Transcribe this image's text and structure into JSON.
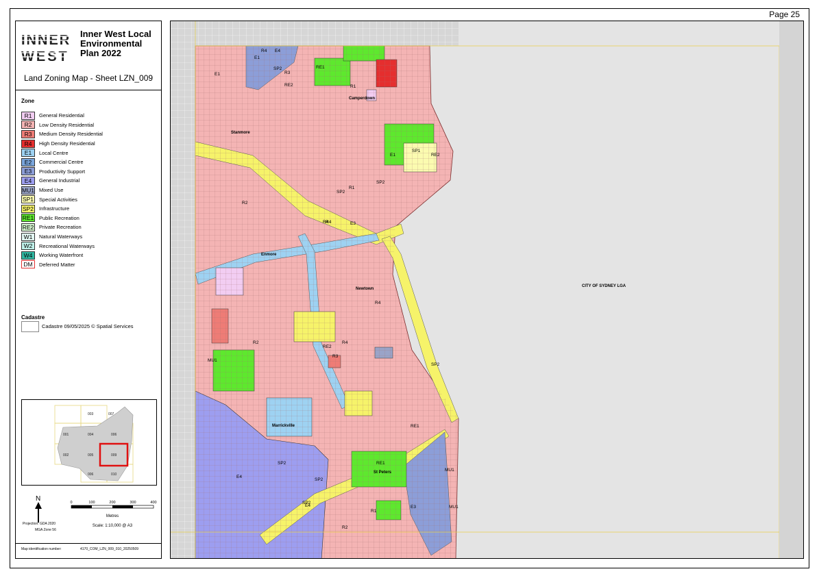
{
  "page": {
    "number": "Page 25"
  },
  "title_block": {
    "plan_title": "Inner West Local Environmental Plan 2022",
    "logo_text": "INNER WEST",
    "sheet_title": "Land Zoning Map - Sheet LZN_009"
  },
  "legend": {
    "heading": "Zone",
    "zones": [
      {
        "code": "R1",
        "label": "General Residential",
        "color": "#f2cdf2"
      },
      {
        "code": "R2",
        "label": "Low Density Residential",
        "color": "#f4b4b4"
      },
      {
        "code": "R3",
        "label": "Medium Density Residential",
        "color": "#ee7c76"
      },
      {
        "code": "R4",
        "label": "High Density Residential",
        "color": "#e52e2e"
      },
      {
        "code": "E1",
        "label": "Local Centre",
        "color": "#9ed2f2"
      },
      {
        "code": "E2",
        "label": "Commercial Centre",
        "color": "#7aa6dc"
      },
      {
        "code": "E3",
        "label": "Productivity Support",
        "color": "#8c9ed8"
      },
      {
        "code": "E4",
        "label": "General Industrial",
        "color": "#9d9ef0"
      },
      {
        "code": "MU1",
        "label": "Mixed Use",
        "color": "#9aa4c8"
      },
      {
        "code": "SP1",
        "label": "Special Activities",
        "color": "#fbfbb0"
      },
      {
        "code": "SP2",
        "label": "Infrastructure",
        "color": "#f6f36a"
      },
      {
        "code": "RE1",
        "label": "Public Recreation",
        "color": "#5ee82e"
      },
      {
        "code": "RE2",
        "label": "Private Recreation",
        "color": "#d2f2cc"
      },
      {
        "code": "W1",
        "label": "Natural Waterways",
        "color": "#e2f6f2"
      },
      {
        "code": "W2",
        "label": "Recreational Waterways",
        "color": "#bff1ea"
      },
      {
        "code": "W4",
        "label": "Working Waterfront",
        "color": "#2fb7a2"
      },
      {
        "code": "DM",
        "label": "Deferred Matter",
        "color": "#ffffff"
      }
    ],
    "cadastre_heading": "Cadastre",
    "cadastre_label": "Cadastre 09/05/2025 © Spatial Services"
  },
  "keymap": {
    "sheets": [
      "001",
      "002",
      "003",
      "004",
      "005",
      "006",
      "007",
      "009",
      "010"
    ],
    "highlight": "009"
  },
  "scale": {
    "ticks": [
      "0",
      "100",
      "200",
      "300",
      "400"
    ],
    "unit": "Metres",
    "text": "Scale: 1:10,000 @ A3",
    "north": "N",
    "projection": "Projection: GDA 2020",
    "zone": "MGA Zone 56"
  },
  "footer": {
    "id_label": "Map identification number:",
    "id_value": "4170_COM_LZN_009_010_20250509"
  },
  "map": {
    "lga_label": "CITY OF SYDNEY LGA",
    "places": [
      "Camperdown",
      "Stanmore",
      "Enmore",
      "Newtown",
      "Marrickville",
      "St Peters"
    ],
    "zone_labels": [
      "R4",
      "E4",
      "E1",
      "SP2",
      "R3",
      "RE1",
      "RE2",
      "R1",
      "E1",
      "R2",
      "R4",
      "SP1",
      "RE2",
      "E1",
      "SP2",
      "R1",
      "R4",
      "E3",
      "RE2",
      "SP2",
      "R4",
      "R4",
      "R3",
      "R2",
      "MU1",
      "SP2",
      "RE1",
      "MU1",
      "E4",
      "SP2",
      "E4",
      "R2",
      "SP2",
      "RE1",
      "R1",
      "E3",
      "SP2",
      "MU1"
    ]
  }
}
